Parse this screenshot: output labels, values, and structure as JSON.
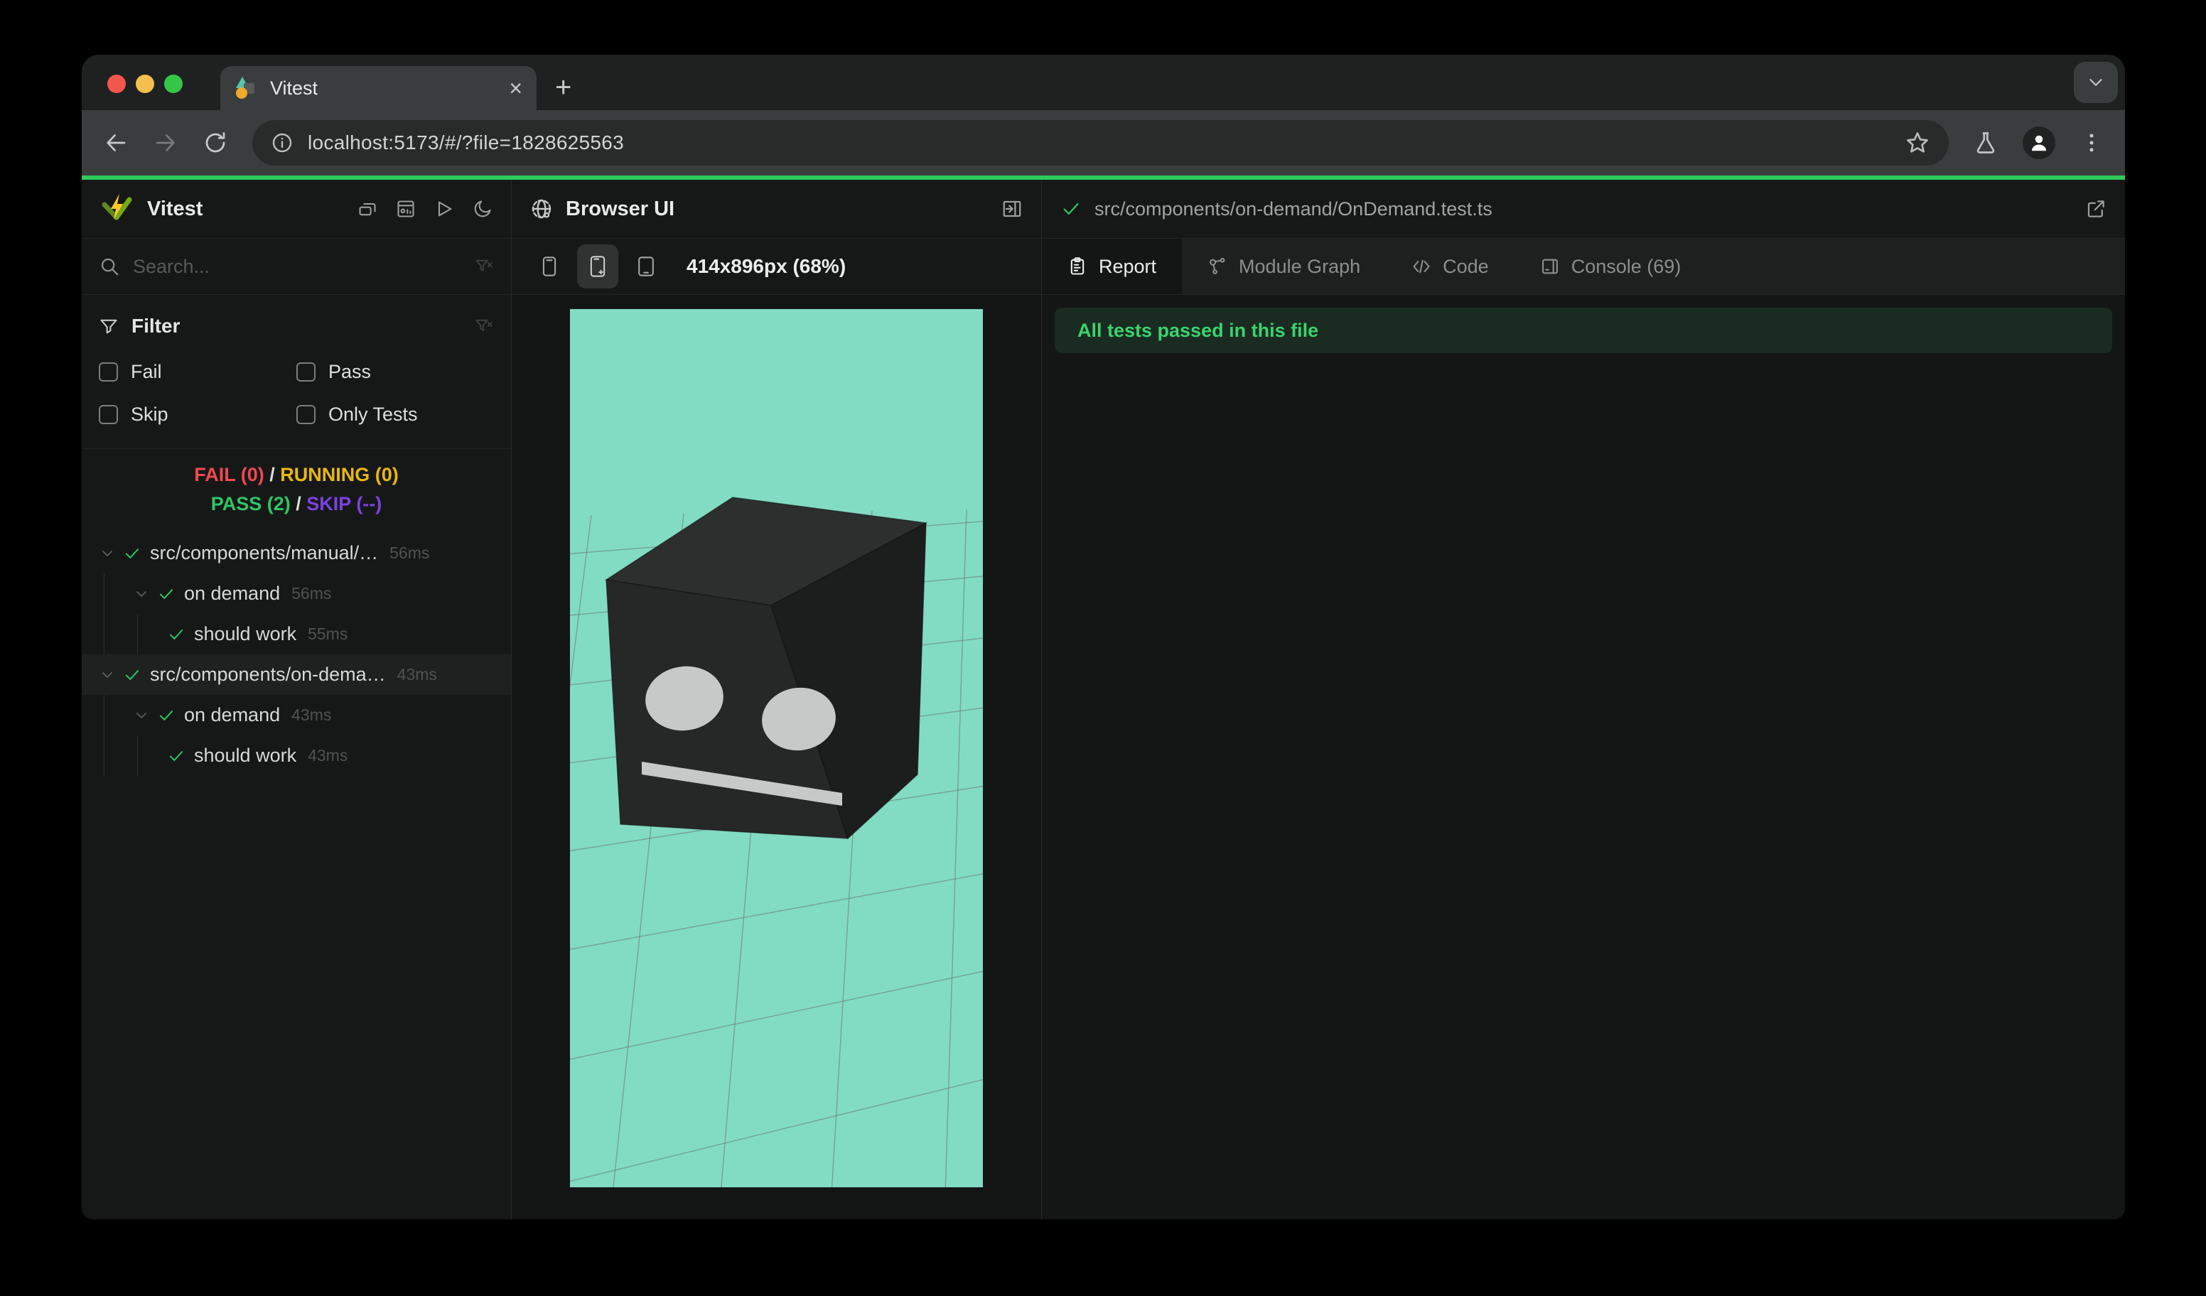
{
  "theme": {
    "accent-green": "#2ecc5b",
    "pass-green": "#30c563",
    "fail-red": "#ef4950",
    "running-yellow": "#e9b713",
    "skip-purple": "#7b42e0",
    "viewport-teal": "#82dcc4",
    "cube-top": "#2d2f2e",
    "cube-front": "#262828",
    "cube-right": "#1c1e1d",
    "banner-bg": "#1a2b21",
    "banner-text": "#3bd36d"
  },
  "icons": {
    "close_glyph": "×",
    "plus_glyph": "+"
  },
  "browser": {
    "tab_title": "Vitest",
    "url": "localhost:5173/#/?file=1828625563"
  },
  "sidebar": {
    "app_title": "Vitest",
    "search_placeholder": "Search...",
    "filter": {
      "title": "Filter",
      "options": [
        "Fail",
        "Pass",
        "Skip",
        "Only Tests"
      ]
    },
    "status": {
      "fail": "FAIL (0)",
      "running": "RUNNING (0)",
      "pass": "PASS (2)",
      "skip": "SKIP (--)",
      "sep": "/"
    },
    "tree": [
      {
        "label": "src/components/manual/…",
        "duration": "56ms"
      },
      {
        "label": "on demand",
        "duration": "56ms"
      },
      {
        "label": "should work",
        "duration": "55ms"
      },
      {
        "label": "src/components/on-dema…",
        "duration": "43ms"
      },
      {
        "label": "on demand",
        "duration": "43ms"
      },
      {
        "label": "should work",
        "duration": "43ms"
      }
    ]
  },
  "browser_panel": {
    "title": "Browser UI",
    "viewport_size": "414x896px (68%)"
  },
  "report_panel": {
    "file_path": "src/components/on-demand/OnDemand.test.ts",
    "tabs": [
      "Report",
      "Module Graph",
      "Code",
      "Console (69)"
    ],
    "banner": "All tests passed in this file"
  }
}
